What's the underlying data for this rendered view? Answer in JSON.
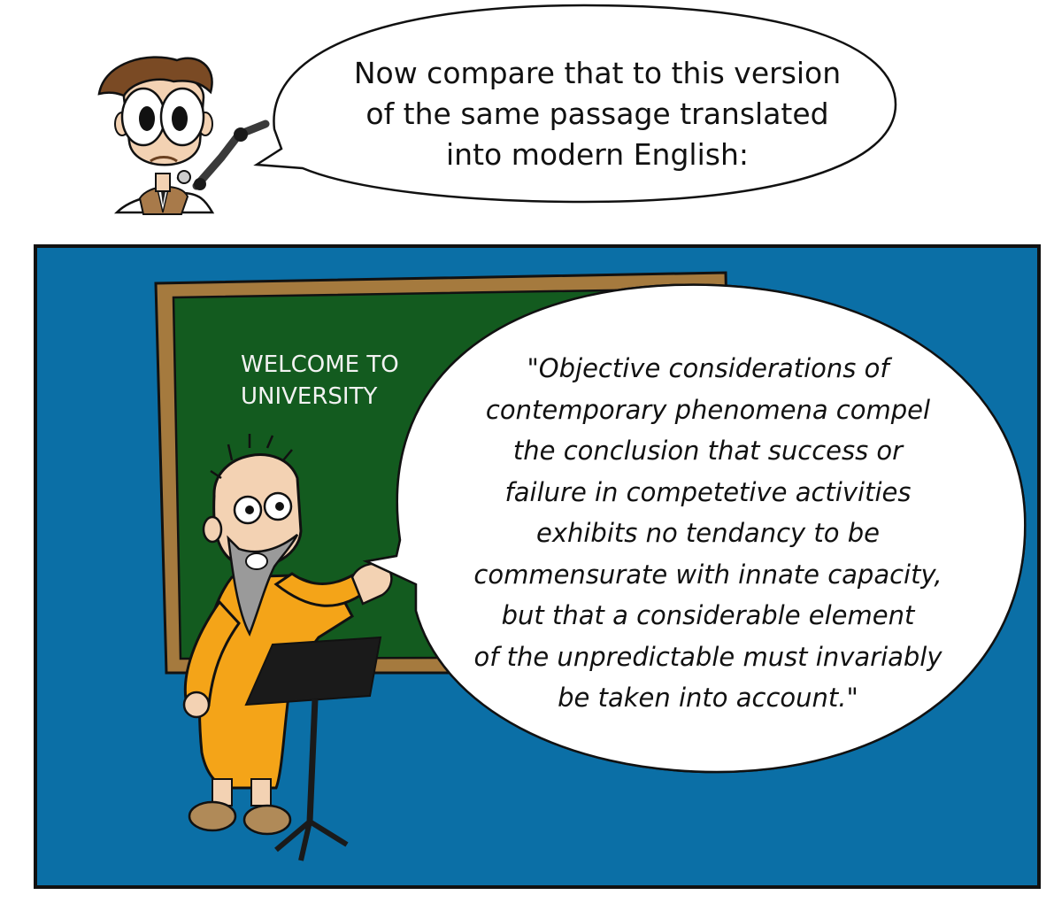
{
  "narrator_bubble": {
    "lines": [
      "Now compare that to this version",
      "of the same passage translated",
      "into modern English:"
    ]
  },
  "chalkboard": {
    "lines": [
      "WELCOME TO",
      "UNIVERSITY"
    ]
  },
  "professor_bubble": {
    "lines": [
      "\"Objective considerations of",
      "contemporary phenomena compel",
      "the conclusion that success or",
      "failure in competetive activities",
      "exhibits no tendancy to be",
      "commensurate with innate capacity,",
      "but that a considerable element",
      "of the unpredictable must invariably",
      "be taken into account.\""
    ]
  },
  "colors": {
    "panel_background": "#0b6fa6",
    "chalkboard_green": "#135b1f",
    "chalkboard_frame": "#a57a3e",
    "robe_orange": "#f4a418",
    "beard_gray": "#9a9a9a",
    "lectern_black": "#1a1a1a"
  }
}
